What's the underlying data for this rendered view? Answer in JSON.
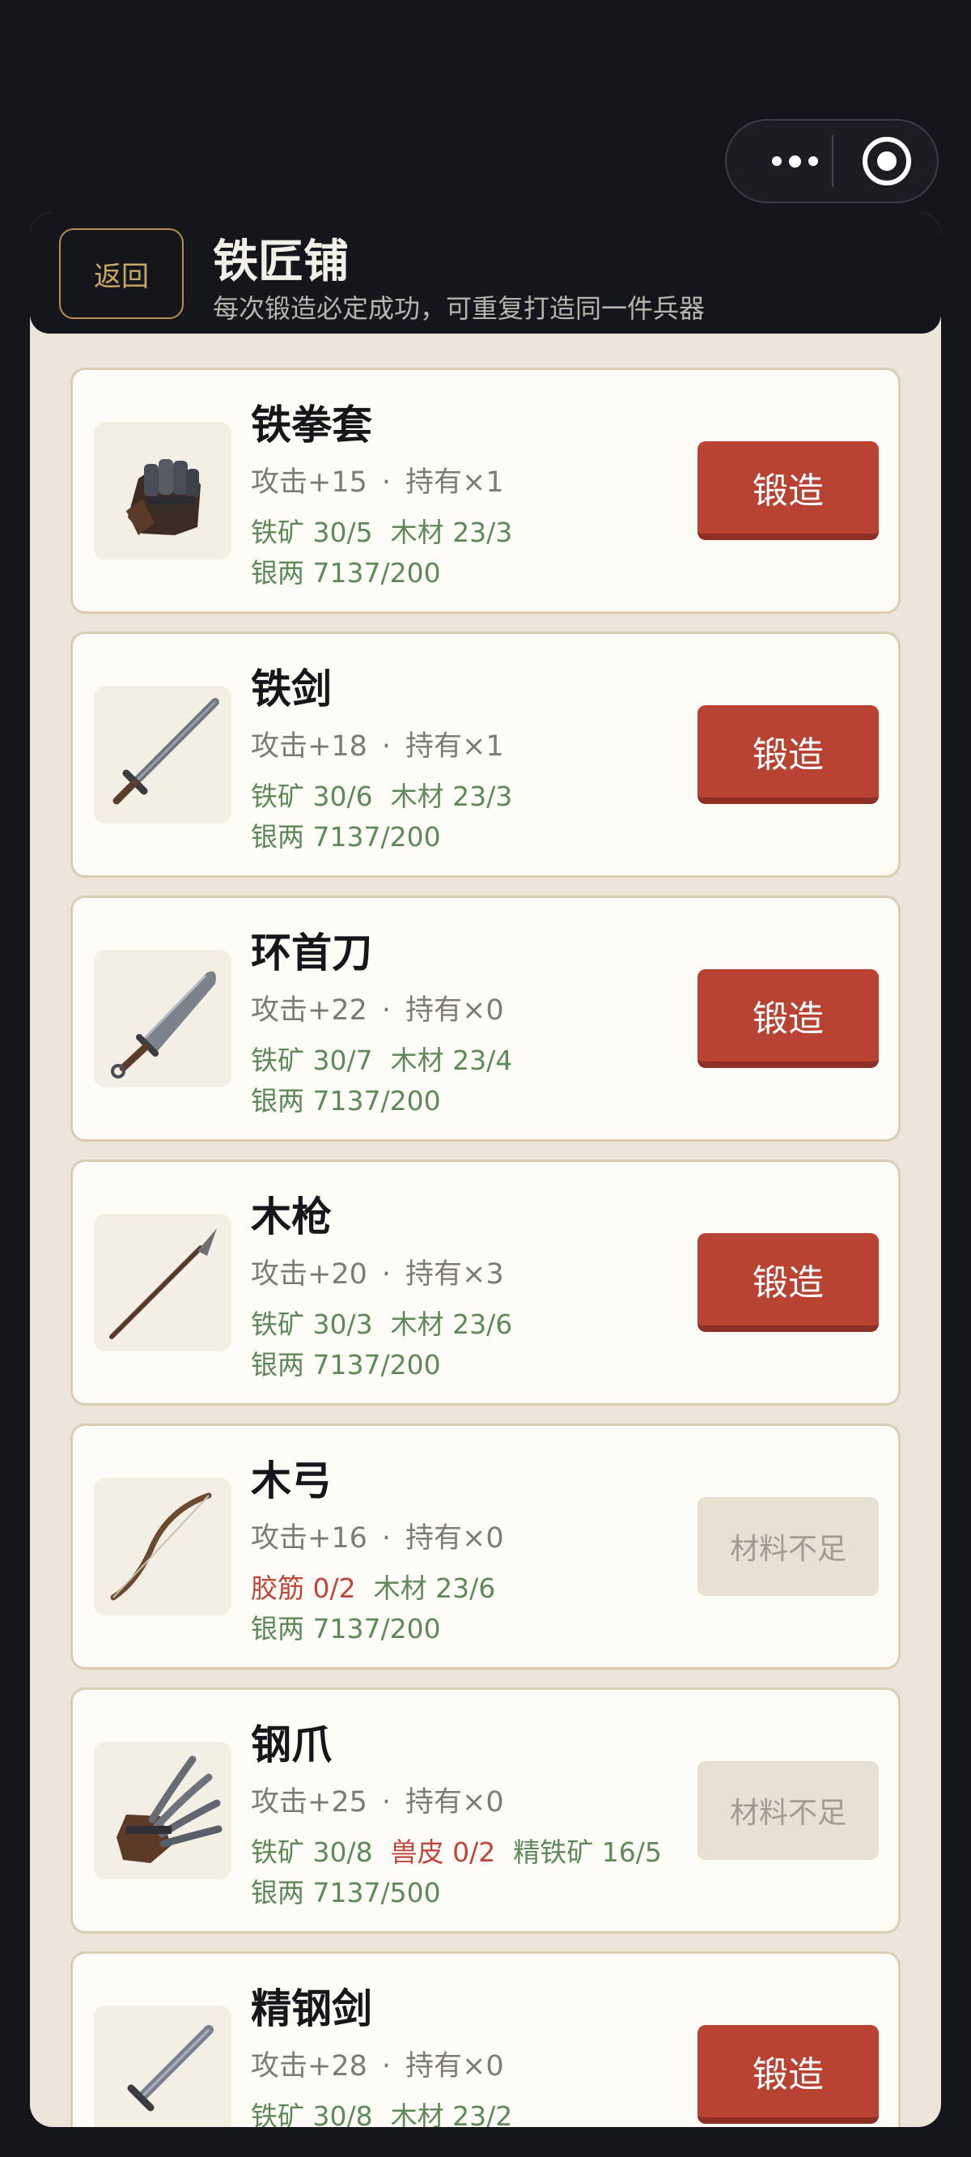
{
  "capsule": {
    "more_icon": "more-dots-icon",
    "close_icon": "target-circle-icon"
  },
  "header": {
    "back_label": "返回",
    "title": "铁匠铺",
    "subtitle": "每次锻造必定成功，可重复打造同一件兵器"
  },
  "items": [
    {
      "name": "铁拳套",
      "attack": "攻击+15",
      "owned": "持有×1",
      "materials": [
        {
          "text": "铁矿 30/5",
          "short": false
        },
        {
          "text": "木材 23/3",
          "short": false
        }
      ],
      "silver": "银两 7137/200",
      "button": "锻造",
      "enabled": true,
      "icon": "iron-gauntlet-icon"
    },
    {
      "name": "铁剑",
      "attack": "攻击+18",
      "owned": "持有×1",
      "materials": [
        {
          "text": "铁矿 30/6",
          "short": false
        },
        {
          "text": "木材 23/3",
          "short": false
        }
      ],
      "silver": "银两 7137/200",
      "button": "锻造",
      "enabled": true,
      "icon": "iron-sword-icon"
    },
    {
      "name": "环首刀",
      "attack": "攻击+22",
      "owned": "持有×0",
      "materials": [
        {
          "text": "铁矿 30/7",
          "short": false
        },
        {
          "text": "木材 23/4",
          "short": false
        }
      ],
      "silver": "银两 7137/200",
      "button": "锻造",
      "enabled": true,
      "icon": "ring-pommel-saber-icon"
    },
    {
      "name": "木枪",
      "attack": "攻击+20",
      "owned": "持有×3",
      "materials": [
        {
          "text": "铁矿 30/3",
          "short": false
        },
        {
          "text": "木材 23/6",
          "short": false
        }
      ],
      "silver": "银两 7137/200",
      "button": "锻造",
      "enabled": true,
      "icon": "wooden-spear-icon"
    },
    {
      "name": "木弓",
      "attack": "攻击+16",
      "owned": "持有×0",
      "materials": [
        {
          "text": "胶筋 0/2",
          "short": true
        },
        {
          "text": "木材 23/6",
          "short": false
        }
      ],
      "silver": "银两 7137/200",
      "button": "材料不足",
      "enabled": false,
      "icon": "wooden-bow-icon"
    },
    {
      "name": "钢爪",
      "attack": "攻击+25",
      "owned": "持有×0",
      "materials": [
        {
          "text": "铁矿 30/8",
          "short": false
        },
        {
          "text": "兽皮 0/2",
          "short": true
        },
        {
          "text": "精铁矿 16/5",
          "short": false
        }
      ],
      "silver": "银两 7137/500",
      "button": "材料不足",
      "enabled": false,
      "icon": "steel-claw-icon"
    },
    {
      "name": "精钢剑",
      "attack": "攻击+28",
      "owned": "持有×0",
      "materials": [
        {
          "text": "铁矿 30/8",
          "short": false
        },
        {
          "text": "木材 23/2",
          "short": false
        }
      ],
      "silver": "",
      "button": "锻造",
      "enabled": true,
      "icon": "refined-steel-sword-icon"
    }
  ],
  "colors": {
    "forge_button": "#b94333",
    "material_ok": "#5d8a58",
    "material_short": "#c0453a",
    "panel_bg": "#ece6da"
  }
}
